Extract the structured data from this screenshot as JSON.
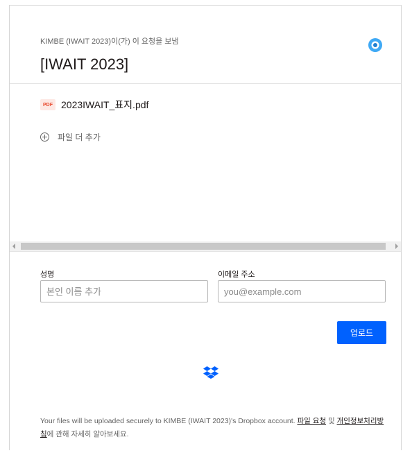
{
  "header": {
    "sender_text": "KIMBE (IWAIT 2023)이(가) 이 요청을 보냄",
    "request_title": "[IWAIT 2023]"
  },
  "files": {
    "items": [
      {
        "badge": "PDF",
        "name": "2023IWAIT_표지.pdf"
      }
    ],
    "add_more_label": "파일 더 추가"
  },
  "form": {
    "name_label": "성명",
    "name_placeholder": "본인 이름 추가",
    "email_label": "이메일 주소",
    "email_placeholder": "you@example.com",
    "upload_label": "업로드"
  },
  "footer": {
    "text_prefix": "Your files will be uploaded securely to KIMBE (IWAIT 2023)'s Dropbox account.",
    "link_file_request": "파일 요청",
    "conjunction": "및",
    "link_privacy": "개인정보처리방침",
    "text_suffix": "에 관해 자세히 알아보세요."
  },
  "colors": {
    "primary": "#0061fe",
    "pdf_red": "#e8472b",
    "dropbox_blue": "#0061fe",
    "logo_blue": "#3fa9f5"
  }
}
